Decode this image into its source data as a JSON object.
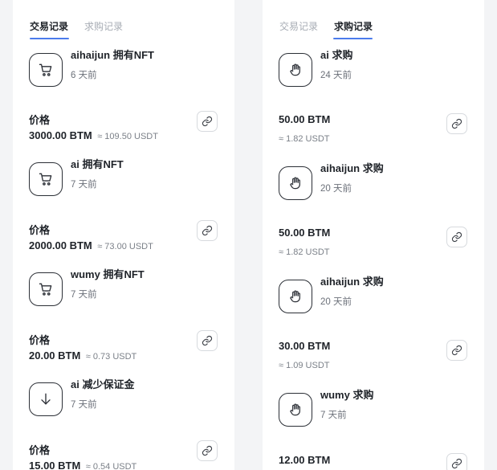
{
  "left_panel": {
    "tabs": [
      {
        "label": "交易记录",
        "active": true
      },
      {
        "label": "求购记录",
        "active": false
      }
    ],
    "records": [
      {
        "icon": "cart-icon",
        "title": "aihaijun 拥有NFT",
        "time": "6 天前",
        "price_label": "价格",
        "amount": "3000.00 BTM",
        "approx": "≈ 109.50 USDT"
      },
      {
        "icon": "cart-icon",
        "title": "ai 拥有NFT",
        "time": "7 天前",
        "price_label": "价格",
        "amount": "2000.00 BTM",
        "approx": "≈ 73.00 USDT"
      },
      {
        "icon": "cart-icon",
        "title": "wumy 拥有NFT",
        "time": "7 天前",
        "price_label": "价格",
        "amount": "20.00 BTM",
        "approx": "≈ 0.73 USDT"
      },
      {
        "icon": "arrow-down-icon",
        "title": "ai 减少保证金",
        "time": "7 天前",
        "price_label": "价格",
        "amount": "15.00 BTM",
        "approx": "≈ 0.54 USDT"
      }
    ]
  },
  "right_panel": {
    "tabs": [
      {
        "label": "交易记录",
        "active": false
      },
      {
        "label": "求购记录",
        "active": true
      }
    ],
    "records": [
      {
        "icon": "hand-icon",
        "title": "ai 求购",
        "time": "24 天前",
        "amount": "50.00 BTM",
        "approx": "≈ 1.82 USDT"
      },
      {
        "icon": "hand-icon",
        "title": "aihaijun 求购",
        "time": "20 天前",
        "amount": "50.00 BTM",
        "approx": "≈ 1.82 USDT"
      },
      {
        "icon": "hand-icon",
        "title": "aihaijun 求购",
        "time": "20 天前",
        "amount": "30.00 BTM",
        "approx": "≈ 1.09 USDT"
      },
      {
        "icon": "hand-icon",
        "title": "wumy 求购",
        "time": "7 天前",
        "amount": "12.00 BTM",
        "approx": ""
      }
    ]
  },
  "colors": {
    "accent": "#4b7bec",
    "text": "#1f2329",
    "muted": "#a7acb4",
    "background": "#f3f4f6"
  }
}
